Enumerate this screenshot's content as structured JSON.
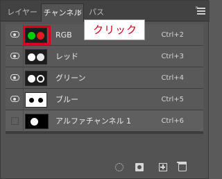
{
  "tabs": [
    {
      "label": "レイヤー",
      "active": false
    },
    {
      "label": "チャンネル",
      "active": true
    },
    {
      "label": "パス",
      "active": false
    }
  ],
  "tooltip": {
    "text": "クリック"
  },
  "channels": [
    {
      "name": "RGB",
      "shortcut": "Ctrl+2",
      "visible": true,
      "thumb_left": "#00d000",
      "thumb_right": "#e21c1c"
    },
    {
      "name": "レッド",
      "shortcut": "Ctrl+3",
      "visible": true,
      "thumb_left": "#ffffff",
      "thumb_right": "#e8e8e8"
    },
    {
      "name": "グリーン",
      "shortcut": "Ctrl+4",
      "visible": true,
      "thumb_left": "#ffffff",
      "thumb_right": "#1c1c1c"
    },
    {
      "name": "ブルー",
      "shortcut": "Ctrl+5",
      "visible": true,
      "thumb_left": "#000000",
      "thumb_right": "#000000"
    },
    {
      "name": "アルファチャンネル 1",
      "shortcut": "Ctrl+6",
      "visible": false
    }
  ],
  "icons": {
    "collapse": "double-chevron-icon",
    "menu": "hamburger-menu-icon",
    "load_selection": "dotted-circle-icon",
    "save_selection": "channel-mask-icon",
    "new_channel": "new-channel-icon",
    "delete": "trash-icon",
    "close_tab": "close-icon"
  },
  "colors": {
    "highlight": "#e3001b",
    "tooltip_text": "#d0021b"
  }
}
